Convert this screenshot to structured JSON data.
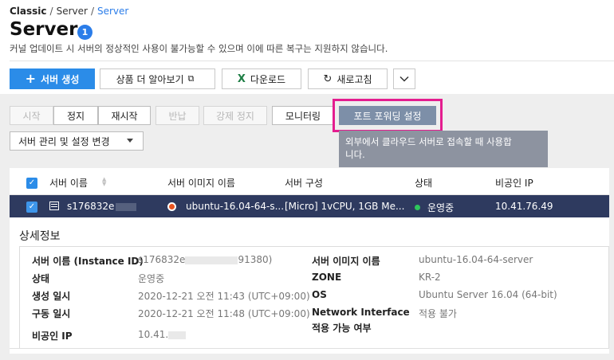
{
  "breadcrumb": {
    "item1": "Classic",
    "item2": "Server",
    "item3": "Server"
  },
  "page": {
    "title": "Server",
    "badge_count": "1",
    "notice": "커널 업데이트 시 서버의 정상적인 사용이 불가능할 수 있으며 이에 따른 복구는 지원하지 않습니다."
  },
  "toolbar": {
    "create_label": "서버 생성",
    "learn_more_label": "상품 더 알아보기",
    "download_label": "다운로드",
    "refresh_label": "새로고침",
    "more_icon": "chevron-down-icon"
  },
  "actions": {
    "start": "시작",
    "stop": "정지",
    "restart": "재시작",
    "return": "반납",
    "force_stop": "강제 정지",
    "monitoring": "모니터링",
    "port_forwarding": "포트 포워딩 설정",
    "manage": "서버 관리 및 설정 변경"
  },
  "tooltip": {
    "line1": "외부에서 클라우드 서버로 접속할 때 사용합",
    "line2": "니다."
  },
  "table": {
    "headers": {
      "name": "서버 이름",
      "image": "서버 이미지 이름",
      "spec": "서버 구성",
      "status": "상태",
      "private_ip": "비공인 IP"
    },
    "row": {
      "name": "s176832e",
      "image": "ubuntu-16.04-64-s...",
      "spec": "[Micro] 1vCPU, 1GB Me...",
      "status": "운영중",
      "private_ip": "10.41.76.49"
    }
  },
  "details": {
    "title": "상세정보",
    "labels": {
      "name": "서버 이름 (Instance ID)",
      "status": "상태",
      "created": "생성 일시",
      "started": "구동 일시",
      "private_ip": "비공인 IP",
      "image": "서버 이미지 이름",
      "zone": "ZONE",
      "os": "OS",
      "netif_1": "Network Interface",
      "netif_2": "적용 가능 여부"
    },
    "values": {
      "name_start": "s176832e",
      "name_end": "91380)",
      "status": "운영중",
      "created": "2020-12-21 오전 11:43 (UTC+09:00)",
      "started": "2020-12-21 오전 11:48 (UTC+09:00)",
      "private_ip": "10.41.",
      "image": "ubuntu-16.04-64-server",
      "zone": "KR-2",
      "os": "Ubuntu Server 16.04 (64-bit)",
      "netif": "적용 불가"
    }
  },
  "colors": {
    "primary": "#2b8ce8",
    "selected_row": "#2e3a5f",
    "highlight": "#e41d8f",
    "status_ok": "#2ec75c"
  }
}
